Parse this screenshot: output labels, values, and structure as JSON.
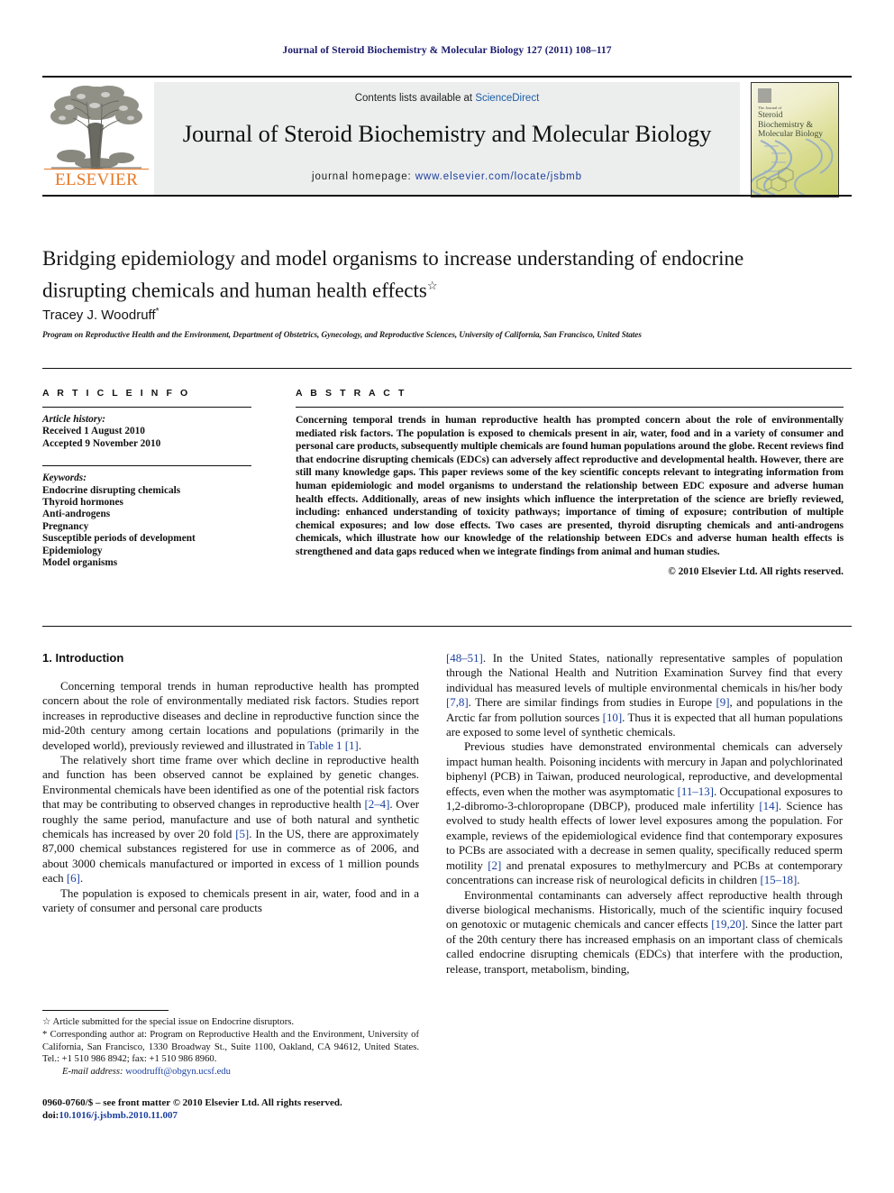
{
  "running_head": "Journal of Steroid Biochemistry & Molecular Biology 127 (2011) 108–117",
  "masthead": {
    "contents_prefix": "Contents lists available at ",
    "sciencedirect": "ScienceDirect",
    "journal_title": "Journal of Steroid Biochemistry and Molecular Biology",
    "homepage_label": "journal homepage:",
    "homepage_url": "www.elsevier.com/locate/jsbmb",
    "publisher": "ELSEVIER",
    "cover_kicker": "The Journal of",
    "cover_title": "Steroid Biochemistry & Molecular Biology"
  },
  "article": {
    "title": "Bridging epidemiology and model organisms to increase understanding of endocrine disrupting chemicals and human health effects",
    "title_mark": "☆",
    "author": "Tracey J. Woodruff",
    "author_mark": "*",
    "affiliation": "Program on Reproductive Health and the Environment, Department of Obstetrics, Gynecology, and Reproductive Sciences, University of California, San Francisco, United States"
  },
  "info": {
    "heading": "A R T I C L E   I N F O",
    "history_label": "Article history:",
    "received": "Received 1 August 2010",
    "accepted": "Accepted 9 November 2010",
    "keywords_label": "Keywords:",
    "keywords": [
      "Endocrine disrupting chemicals",
      "Thyroid hormones",
      "Anti-androgens",
      "Pregnancy",
      "Susceptible periods of development",
      "Epidemiology",
      "Model organisms"
    ]
  },
  "abstract": {
    "heading": "A B S T R A C T",
    "text": "Concerning temporal trends in human reproductive health has prompted concern about the role of environmentally mediated risk factors. The population is exposed to chemicals present in air, water, food and in a variety of consumer and personal care products, subsequently multiple chemicals are found human populations around the globe. Recent reviews find that endocrine disrupting chemicals (EDCs) can adversely affect reproductive and developmental health. However, there are still many knowledge gaps. This paper reviews some of the key scientific concepts relevant to integrating information from human epidemiologic and model organisms to understand the relationship between EDC exposure and adverse human health effects. Additionally, areas of new insights which influence the interpretation of the science are briefly reviewed, including: enhanced understanding of toxicity pathways; importance of timing of exposure; contribution of multiple chemical exposures; and low dose effects. Two cases are presented, thyroid disrupting chemicals and anti-androgens chemicals, which illustrate how our knowledge of the relationship between EDCs and adverse human health effects is strengthened and data gaps reduced when we integrate findings from animal and human studies.",
    "copyright": "© 2010 Elsevier Ltd. All rights reserved."
  },
  "body": {
    "section_title": "1. Introduction",
    "left_paragraphs": [
      "Concerning temporal trends in human reproductive health has prompted concern about the role of environmentally mediated risk factors. Studies report increases in reproductive diseases and decline in reproductive function since the mid-20th century among certain locations and populations (primarily in the developed world), previously reviewed and illustrated in Table 1 [1].",
      "The relatively short time frame over which decline in reproductive health and function has been observed cannot be explained by genetic changes. Environmental chemicals have been identified as one of the potential risk factors that may be contributing to observed changes in reproductive health [2–4]. Over roughly the same period, manufacture and use of both natural and synthetic chemicals has increased by over 20 fold [5]. In the US, there are approximately 87,000 chemical substances registered for use in commerce as of 2006, and about 3000 chemicals manufactured or imported in excess of 1 million pounds each [6].",
      "The population is exposed to chemicals present in air, water, food and in a variety of consumer and personal care products"
    ],
    "right_paragraphs": [
      "[48–51]. In the United States, nationally representative samples of population through the National Health and Nutrition Examination Survey find that every individual has measured levels of multiple environmental chemicals in his/her body [7,8]. There are similar findings from studies in Europe [9], and populations in the Arctic far from pollution sources [10]. Thus it is expected that all human populations are exposed to some level of synthetic chemicals.",
      "Previous studies have demonstrated environmental chemicals can adversely impact human health. Poisoning incidents with mercury in Japan and polychlorinated biphenyl (PCB) in Taiwan, produced neurological, reproductive, and developmental effects, even when the mother was asymptomatic [11–13]. Occupational exposures to 1,2-dibromo-3-chloropropane (DBCP), produced male infertility [14]. Science has evolved to study health effects of lower level exposures among the population. For example, reviews of the epidemiological evidence find that contemporary exposures to PCBs are associated with a decrease in semen quality, specifically reduced sperm motility [2] and prenatal exposures to methylmercury and PCBs at contemporary concentrations can increase risk of neurological deficits in children [15–18].",
      "Environmental contaminants can adversely affect reproductive health through diverse biological mechanisms. Historically, much of the scientific inquiry focused on genotoxic or mutagenic chemicals and cancer effects [19,20]. Since the latter part of the 20th century there has increased emphasis on an important class of chemicals called endocrine disrupting chemicals (EDCs) that interfere with the production, release, transport, metabolism, binding,"
    ]
  },
  "footnotes": {
    "star_note": "☆ Article submitted for the special issue on Endocrine disruptors.",
    "corresponding": "* Corresponding author at: Program on Reproductive Health and the Environment, University of California, San Francisco, 1330 Broadway St., Suite 1100, Oakland, CA 94612, United States. Tel.: +1 510 986 8942; fax: +1 510 986 8960.",
    "email_label": "E-mail address:",
    "email": "woodrufft@obgyn.ucsf.edu"
  },
  "imprint": {
    "issn_line": "0960-0760/$ – see front matter © 2010 Elsevier Ltd. All rights reserved.",
    "doi_prefix": "doi:",
    "doi": "10.1016/j.jsbmb.2010.11.007"
  },
  "colors": {
    "running_head": "#1a1a6e",
    "link": "#1a3f9e",
    "sciencedirect": "#1a5ea8",
    "elsevier_orange": "#E87722"
  }
}
